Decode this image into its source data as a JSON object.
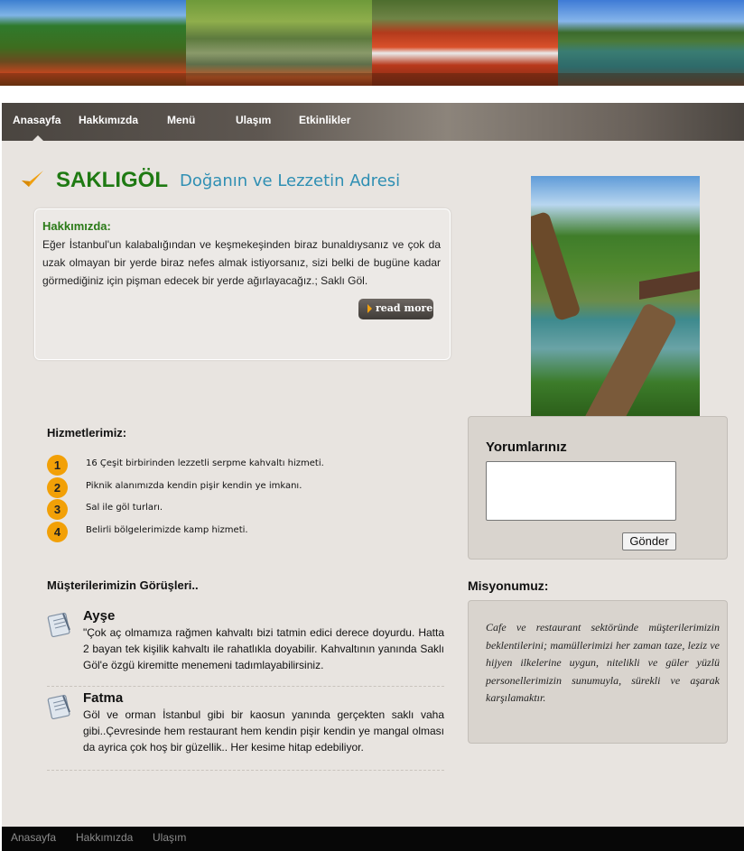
{
  "nav": {
    "items": [
      "Anasayfa",
      "Hakkımızda",
      "Menü",
      "Ulaşım",
      "Etkinlikler"
    ]
  },
  "header": {
    "title": "SAKLIGÖL",
    "subtitle": "Doğanın ve Lezzetin Adresi"
  },
  "about": {
    "title": "Hakkımızda:",
    "text": "Eğer İstanbul'un kalabalığından ve keşmekeşinden biraz bunaldıysanız ve çok da uzak olmayan bir yerde biraz nefes almak istiyorsanız, sizi belki de bugüne kadar görmediğiniz için pişman edecek bir yerde ağırlayacağız.; Saklı Göl.",
    "read_more": "read more"
  },
  "services": {
    "title": "Hizmetlerimiz:",
    "items": [
      {
        "num": "1",
        "text": "16 Çeşit birbirinden lezzetli serpme kahvaltı hizmeti."
      },
      {
        "num": "2",
        "text": "Piknik alanımızda kendin pişir kendin ye imkanı."
      },
      {
        "num": "3",
        "text": "Sal ile göl turları."
      },
      {
        "num": "4",
        "text": "Belirli bölgelerimizde kamp hizmeti."
      }
    ]
  },
  "comments": {
    "title": "Yorumlarınız",
    "input_value": "",
    "send_label": "Gönder"
  },
  "opinions": {
    "title": "Müşterilerimizin Görüşleri..",
    "items": [
      {
        "name": "Ayşe",
        "text": "\"Çok aç olmamıza rağmen kahvaltı bizi tatmin edici derece doyurdu. Hatta 2 bayan tek kişilik kahvaltı ile rahatlıkla doyabilir. Kahvaltının yanında Saklı Göl'e özgü kiremitte menemeni tadımlayabilirsiniz."
      },
      {
        "name": "Fatma",
        "text": "Göl ve orman İstanbul gibi bir kaosun yanında gerçekten saklı vaha gibi..Çevresinde hem restaurant hem kendin pişir kendin ye mangal olması da ayrica çok hoş bir güzellik.. Her kesime hitap edebiliyor."
      }
    ]
  },
  "mission": {
    "title": "Misyonumuz:",
    "text": "Cafe ve restaurant sektöründe müşterilerimizin beklentilerini; mamüllerimizi her zaman taze, leziz ve hijyen ilkelerine uygun, nitelikli ve güler yüzlü personellerimizin sunumuyla, sürekli ve aşarak karşılamaktır."
  },
  "footer": {
    "links": [
      "Anasayfa",
      "Hakkımızda",
      "Ulaşım"
    ]
  },
  "colors": {
    "title_green": "#1f7a13",
    "subtitle_blue": "#2f8fb3",
    "badge_orange": "#f2a007",
    "panel_bg": "#e8e4e0"
  }
}
